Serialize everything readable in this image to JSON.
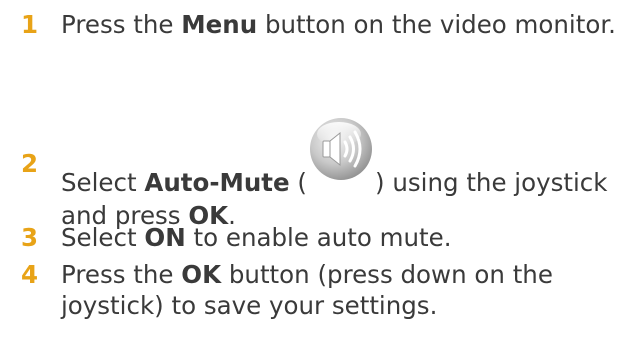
{
  "steps": [
    {
      "number": "1",
      "pre": "Press the ",
      "bold": "Menu",
      "post": " button on the video monitor."
    },
    {
      "number": "2",
      "pre": "Select ",
      "bold": "Auto-Mute",
      "open_paren": " (",
      "icon": "speaker-volume-icon",
      "close_paren": ") using the joystick",
      "line2_pre": "and press ",
      "line2_bold": "OK",
      "line2_post": "."
    },
    {
      "number": "3",
      "pre": "Select ",
      "bold": "ON",
      "post": " to enable auto mute."
    },
    {
      "number": "4",
      "pre": "Press the ",
      "bold": "OK",
      "post": " button (press down on the",
      "line2": "joystick) to save your settings."
    }
  ],
  "colors": {
    "step_number": "#e8a317",
    "text": "#3a3a3a"
  }
}
